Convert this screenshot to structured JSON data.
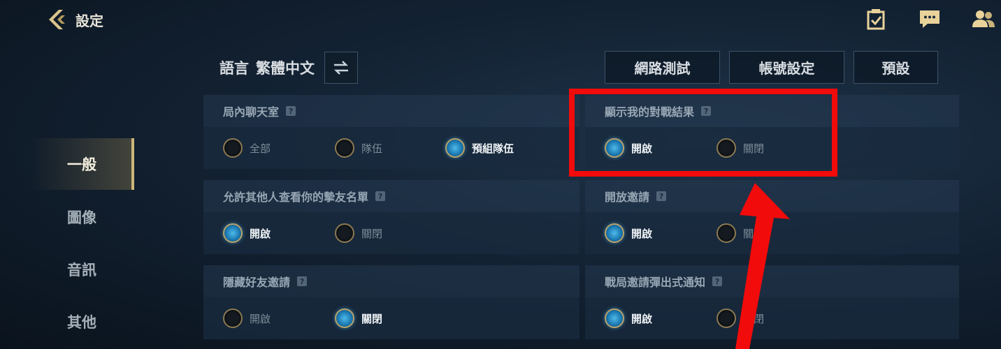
{
  "header": {
    "title": "設定"
  },
  "sidebar": {
    "items": [
      {
        "label": "一般"
      },
      {
        "label": "圖像"
      },
      {
        "label": "音訊"
      },
      {
        "label": "其他"
      }
    ]
  },
  "language": {
    "label": "語言",
    "value": "繁體中文"
  },
  "buttons": {
    "network_test": "網路測試",
    "account_settings": "帳號設定",
    "defaults": "預設"
  },
  "help_glyph": "?",
  "settings": {
    "chat": {
      "title": "局內聊天室",
      "options": [
        "全部",
        "隊伍",
        "預組隊伍"
      ],
      "selected": 2
    },
    "show_results": {
      "title": "顯示我的對戰結果",
      "options": [
        "開啟",
        "關閉"
      ],
      "selected": 0
    },
    "friend_list": {
      "title": "允許其他人查看你的摯友名單",
      "options": [
        "開啟",
        "關閉"
      ],
      "selected": 0
    },
    "open_invite": {
      "title": "開放邀請",
      "options": [
        "開啟",
        "關閉"
      ],
      "selected": 0
    },
    "hide_invites": {
      "title": "隱藏好友邀請",
      "options": [
        "開啟",
        "關閉"
      ],
      "selected": 1
    },
    "popup_notice": {
      "title": "戰局邀請彈出式通知",
      "options": [
        "開啟",
        "關閉"
      ],
      "selected": 0
    }
  },
  "colors": {
    "accent_gold": "#cdb67a",
    "radio_on": "#4fb9e8",
    "annotation_red": "#f10b0b"
  },
  "icons": {
    "back": "back-chevron-icon",
    "task": "task-checklist-icon",
    "chat": "chat-bubble-icon",
    "friends": "friends-icon",
    "swap": "swap-arrows-icon"
  }
}
